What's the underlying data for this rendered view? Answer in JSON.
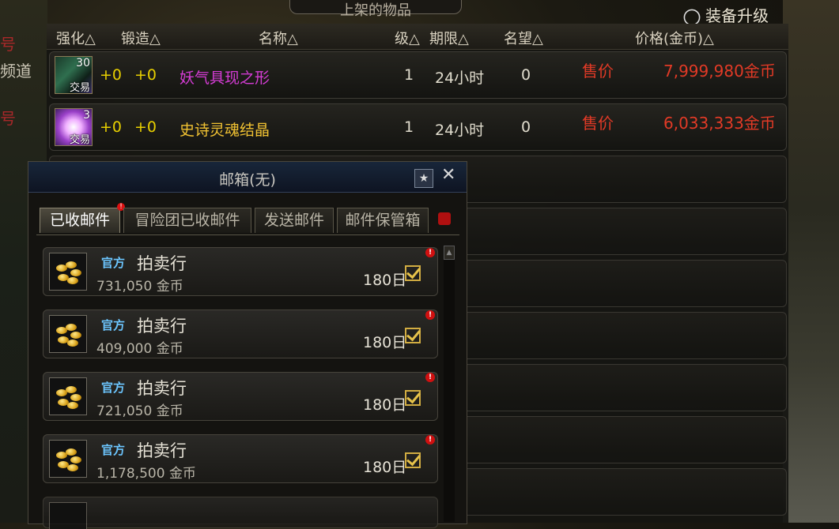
{
  "background": {
    "left_texts": [
      "号",
      "频道",
      "号"
    ],
    "right_texts": []
  },
  "top_label": "上架的物品",
  "upgrade_label": "装备升级",
  "market": {
    "headers": [
      "强化△",
      "锻造△",
      "名称△",
      "级△",
      "期限△",
      "名望△",
      "价格(金币)△"
    ],
    "rows": [
      {
        "icon": "demonic-aura-icon",
        "icon_level": "30",
        "icon_trade": "交易",
        "enhance": "+0",
        "forge": "+0",
        "name": "妖气具现之形",
        "name_color": "#d43cd4",
        "level": "1",
        "duration": "24小时",
        "fame": "0",
        "label": "售价",
        "price": "7,999,980金币"
      },
      {
        "icon": "epic-soul-crystal-icon",
        "icon_level": "3",
        "icon_trade": "交易",
        "enhance": "+0",
        "forge": "+0",
        "name": "史诗灵魂结晶",
        "name_color": "#f1c232",
        "level": "1",
        "duration": "24小时",
        "fame": "0",
        "label": "售价",
        "price": "6,033,333金币"
      }
    ]
  },
  "mailbox": {
    "title": "邮箱(无)",
    "tabs": [
      "已收邮件",
      "冒险团已收邮件",
      "发送邮件",
      "邮件保管箱"
    ],
    "tab_badge": "!",
    "mails": [
      {
        "badge": "官方",
        "sender": "拍卖行",
        "amount": "731,050",
        "currency": "金币",
        "days": "180日",
        "alert": "!"
      },
      {
        "badge": "官方",
        "sender": "拍卖行",
        "amount": "409,000",
        "currency": "金币",
        "days": "180日",
        "alert": "!"
      },
      {
        "badge": "官方",
        "sender": "拍卖行",
        "amount": "721,050",
        "currency": "金币",
        "days": "180日",
        "alert": "!"
      },
      {
        "badge": "官方",
        "sender": "拍卖行",
        "amount": "1,178,500",
        "currency": "金币",
        "days": "180日",
        "alert": "!"
      }
    ]
  },
  "colors": {
    "price_red": "#e23a26",
    "plus_yellow": "#e8d000",
    "official_blue": "#6cc6ff"
  }
}
